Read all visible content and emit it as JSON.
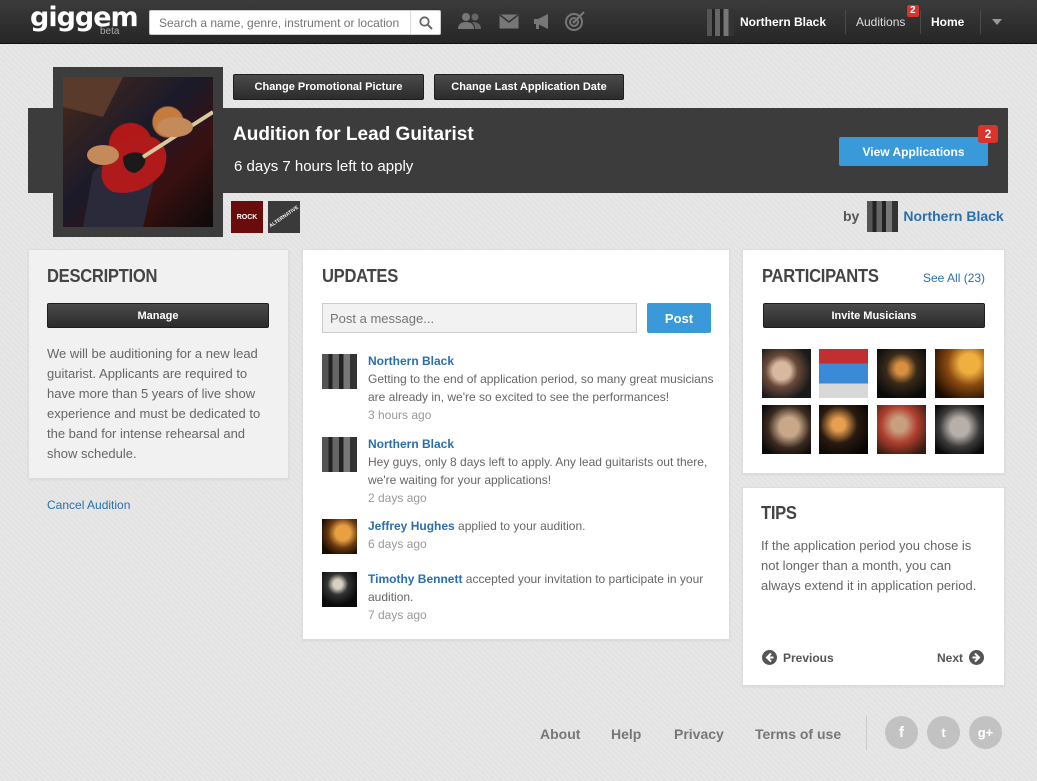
{
  "topbar": {
    "logo": "giggem",
    "logo_sub": "beta",
    "search_placeholder": "Search a name, genre, instrument or location",
    "user_name": "Northern Black",
    "auditions_label": "Auditions",
    "auditions_badge": "2",
    "home_label": "Home"
  },
  "banner": {
    "change_picture_label": "Change Promotional Picture",
    "change_date_label": "Change Last Application Date",
    "title": "Audition for Lead Guitarist",
    "time_left": "6 days 7 hours left to apply",
    "view_applications_label": "View Applications",
    "applications_badge": "2",
    "genres": [
      "ROCK",
      "ALTERNATIVE"
    ],
    "by_label": "by",
    "by_name": "Northern Black"
  },
  "description": {
    "title": "DESCRIPTION",
    "manage_label": "Manage",
    "text": "We will be auditioning for a new lead guitarist. Applicants are required to have more than 5 years of live show experience and must be dedicated to the band for intense rehearsal and show schedule.",
    "cancel_label": "Cancel Audition"
  },
  "updates": {
    "title": "UPDATES",
    "post_placeholder": "Post a message...",
    "post_label": "Post",
    "items": [
      {
        "name": "Northern Black",
        "text": "Getting to the end of application period, so many great musicians are already in, we're so excited to see the performances!",
        "time": "3 hours ago"
      },
      {
        "name": "Northern Black",
        "text": "Hey guys, only 8 days left to apply. Any lead guitarists out there, we're waiting for your applications!",
        "time": "2 days ago"
      },
      {
        "name": "Jeffrey Hughes",
        "text": " applied to your audition.",
        "time": "6 days ago"
      },
      {
        "name": "Timothy Bennett",
        "text": " accepted your invitation to participate in your audition.",
        "time": "7 days ago"
      }
    ]
  },
  "participants": {
    "title": "PARTICIPANTS",
    "see_all_label": "See All (23)",
    "invite_label": "Invite Musicians"
  },
  "tips": {
    "title": "TIPS",
    "text": "If the application period you chose is not longer than a month, you can always extend it in application period.",
    "previous_label": "Previous",
    "next_label": "Next"
  },
  "footer": {
    "about": "About",
    "help": "Help",
    "privacy": "Privacy",
    "terms": "Terms of use",
    "social": [
      "f",
      "t",
      "g+"
    ]
  }
}
